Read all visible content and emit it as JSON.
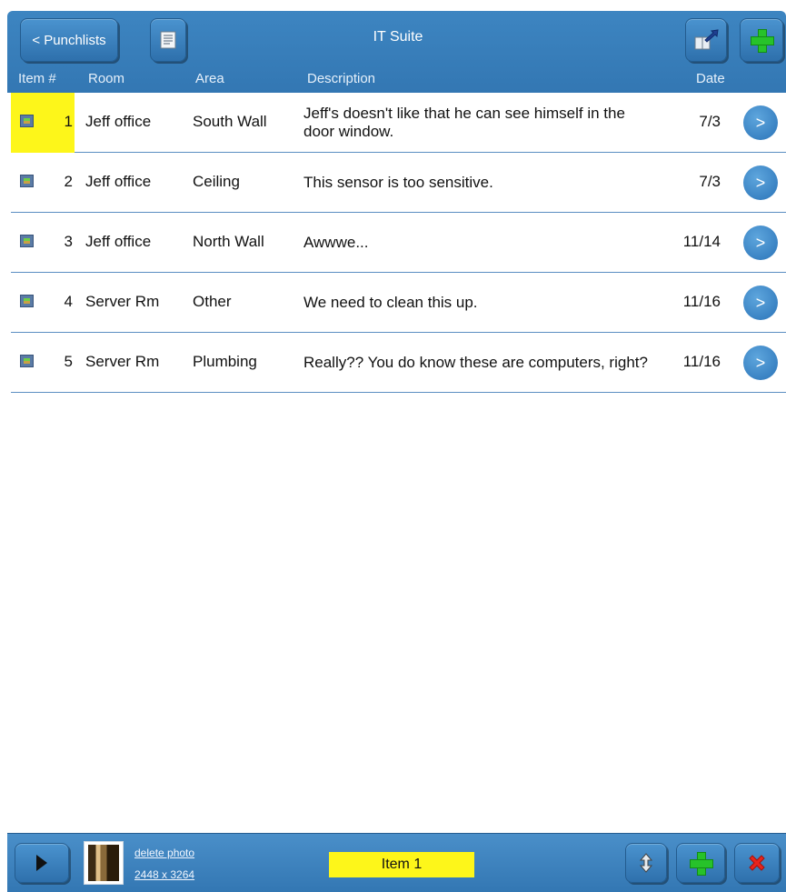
{
  "header": {
    "back_label": "< Punchlists",
    "title": "IT Suite",
    "list_icon": "document-list-icon",
    "export_icon": "export-book-icon",
    "add_icon": "plus-icon"
  },
  "columns": {
    "item": "Item #",
    "room": "Room",
    "area": "Area",
    "description": "Description",
    "date": "Date"
  },
  "rows": [
    {
      "num": "1",
      "room": "Jeff office",
      "area": "South Wall",
      "description": "Jeff's doesn't like that he can see himself in the door window.",
      "date": "7/3",
      "go": ">"
    },
    {
      "num": "2",
      "room": "Jeff office",
      "area": "Ceiling",
      "description": "This sensor is too sensitive.",
      "date": "7/3",
      "go": ">"
    },
    {
      "num": "3",
      "room": "Jeff office",
      "area": "North Wall",
      "description": "Awwwe...",
      "date": "11/14",
      "go": ">"
    },
    {
      "num": "4",
      "room": "Server Rm",
      "area": "Other",
      "description": "We need to clean this up.",
      "date": "11/16",
      "go": ">"
    },
    {
      "num": "5",
      "room": "Server Rm",
      "area": "Plumbing",
      "description": "Really?? You do know these are computers, right?",
      "date": "11/16",
      "go": ">"
    }
  ],
  "footer": {
    "delete_photo": "delete photo",
    "photo_size": "2448 x 3264",
    "item_label": "Item 1"
  },
  "colors": {
    "header_blue": "#3d85c1",
    "selected_yellow": "#fdf61a",
    "delete_red": "#e8241c",
    "add_green": "#27c22a"
  }
}
